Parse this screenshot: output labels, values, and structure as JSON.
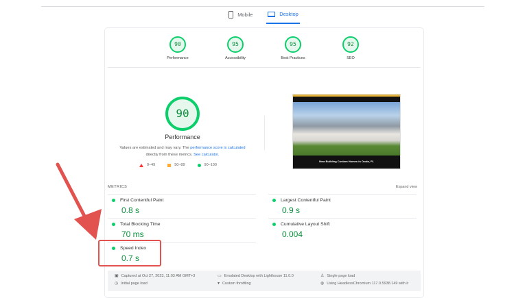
{
  "tabs": [
    {
      "label": "Mobile",
      "icon": "mobile-icon",
      "active": false
    },
    {
      "label": "Desktop",
      "icon": "desktop-icon",
      "active": true
    }
  ],
  "categories": [
    {
      "score": "90",
      "label": "Performance"
    },
    {
      "score": "95",
      "label": "Accessibility"
    },
    {
      "score": "95",
      "label": "Best Practices"
    },
    {
      "score": "92",
      "label": "SEO"
    }
  ],
  "performance": {
    "score": "90",
    "title": "Performance",
    "desc1": "Values are estimated and may vary. The ",
    "link1": "performance score is calculated",
    "desc2": "directly from these metrics. ",
    "link2": "See calculator.",
    "legend": [
      "0–49",
      "50–89",
      "90–100"
    ]
  },
  "screenshot": {
    "caption": "Now Building Custom Homes in Ocala, FL"
  },
  "metrics": {
    "heading": "METRICS",
    "expand": "Expand view",
    "items": [
      {
        "label": "First Contentful Paint",
        "value": "0.8 s"
      },
      {
        "label": "Largest Contentful Paint",
        "value": "0.9 s"
      },
      {
        "label": "Total Blocking Time",
        "value": "70 ms"
      },
      {
        "label": "Cumulative Layout Shift",
        "value": "0.004"
      },
      {
        "label": "Speed Index",
        "value": "0.7 s"
      }
    ]
  },
  "footer": [
    "Captured at Oct 27, 2023, 11:03 AM GMT+3",
    "Initial page load",
    "Emulated Desktop with Lighthouse 11.0.0",
    "Custom throttling",
    "Single page load",
    "Using HeadlessChromium 117.0.5938.149 with lr"
  ],
  "colors": {
    "good": "#0cce6b",
    "annotation": "#e2524e",
    "accent": "#1a73e8"
  }
}
